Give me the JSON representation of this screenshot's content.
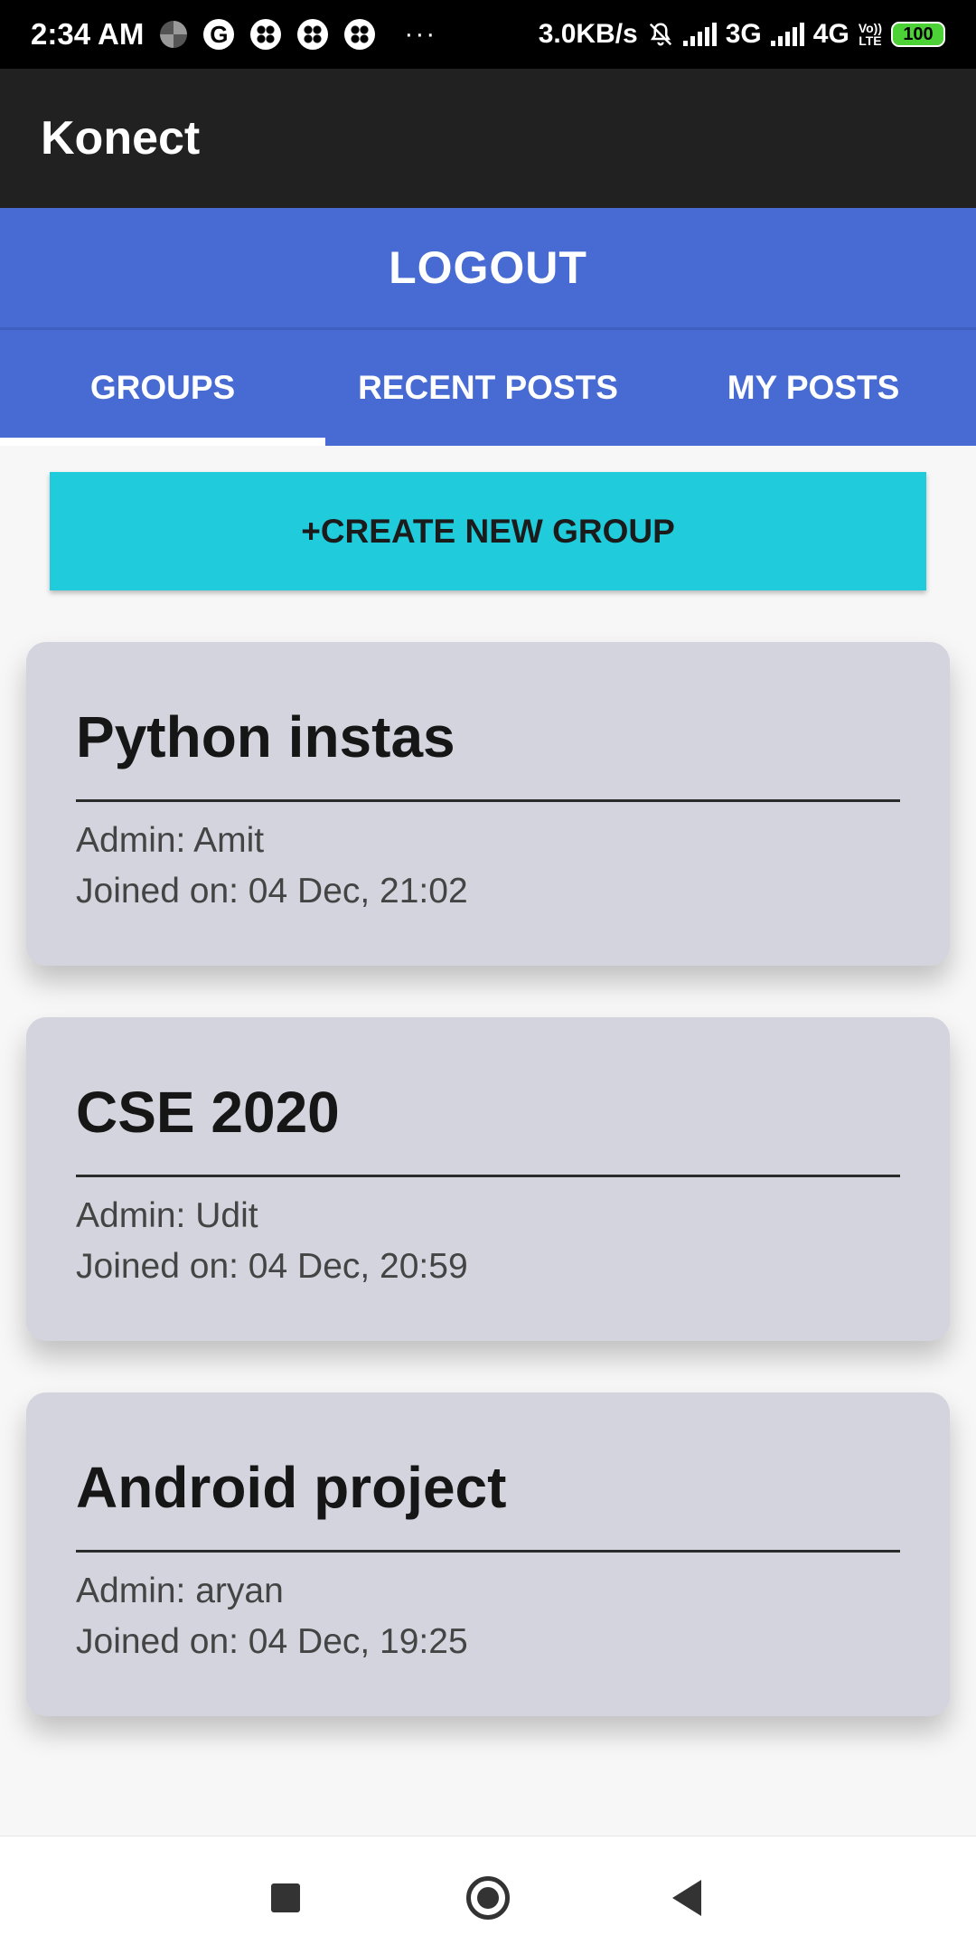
{
  "status_bar": {
    "time": "2:34 AM",
    "g_glyph": "G",
    "dots": "···",
    "net_speed": "3.0KB/s",
    "network_1": "3G",
    "network_2": "4G",
    "lte_top": "Vo))",
    "lte_bottom": "LTE",
    "battery": "100"
  },
  "app_bar": {
    "title": "Konect"
  },
  "logout": {
    "label": "LOGOUT"
  },
  "tabs": [
    {
      "label": "GROUPS",
      "selected": true
    },
    {
      "label": "RECENT POSTS",
      "selected": false
    },
    {
      "label": "MY POSTS",
      "selected": false
    }
  ],
  "create_group": {
    "label": "+CREATE NEW GROUP"
  },
  "groups": [
    {
      "name": "Python instas",
      "admin": "Admin: Amit",
      "joined": "Joined on: 04 Dec, 21:02"
    },
    {
      "name": "CSE 2020",
      "admin": "Admin: Udit",
      "joined": "Joined on: 04 Dec, 20:59"
    },
    {
      "name": "Android project",
      "admin": "Admin: aryan",
      "joined": "Joined on: 04 Dec, 19:25"
    }
  ],
  "colors": {
    "accent": "#476bd3",
    "create_button": "#20cbdc",
    "app_bar": "#212121",
    "card": "#d4d4de"
  },
  "icons": {
    "nav_recents": "recents-square-icon",
    "nav_home": "home-circle-icon",
    "nav_back": "back-triangle-icon"
  }
}
